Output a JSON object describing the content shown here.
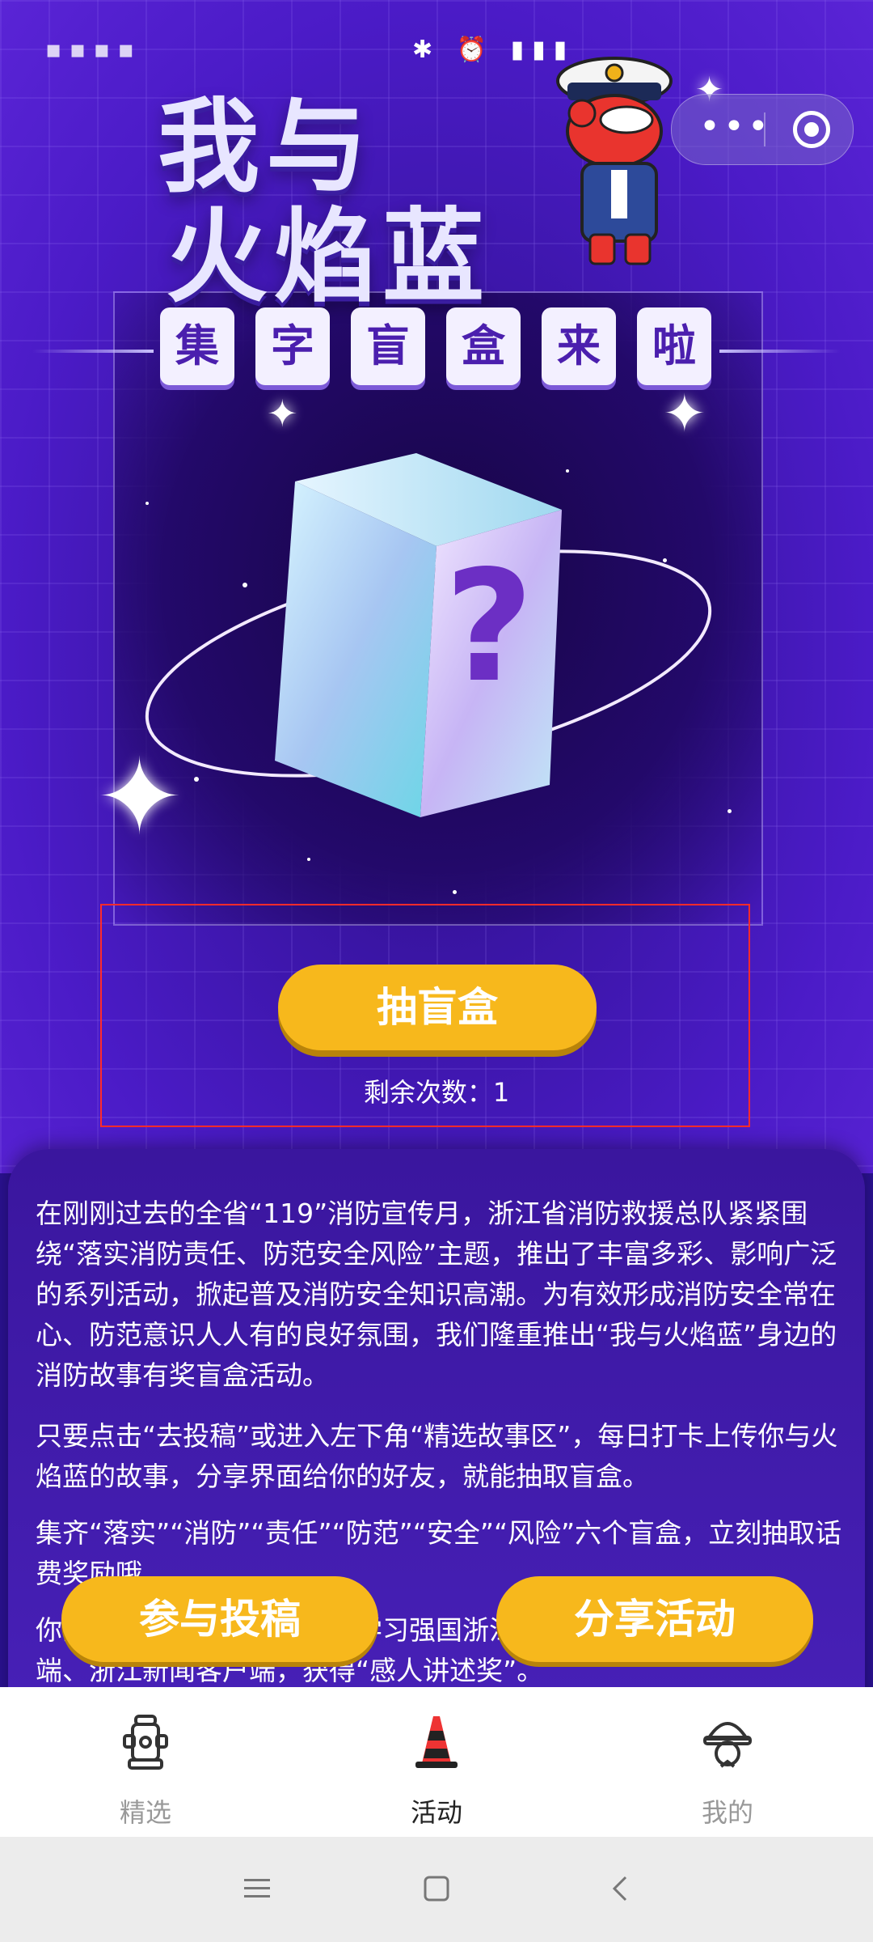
{
  "title": {
    "line1": "我与",
    "line2": "火焰蓝",
    "tiles": [
      "集",
      "字",
      "盲",
      "盒",
      "来",
      "啦"
    ]
  },
  "hero": {
    "draw_button": "抽盲盒",
    "remaining": "剩余次数：1"
  },
  "article": {
    "p1": "在刚刚过去的全省“119”消防宣传月，浙江省消防救援总队紧紧围绕“落实消防责任、防范安全风险”主题，推出了丰富多彩、影响广泛的系列活动，掀起普及消防安全知识高潮。为有效形成消防安全常在心、防范意识人人有的良好氛围，我们隆重推出“我与火焰蓝”身边的消防故事有奖盲盒活动。",
    "p2": "只要点击“去投稿”或进入左下角“精选故事区”，每日打卡上传你与火焰蓝的故事，分享界面给你的好友，就能抽取盲盒。",
    "p3": "集齐“落实”“消防”“责任”“防范”“安全”“风险”六个盲盒，立刻抽取话费奖励哦。",
    "p4": "你的故事还有机会被选送至学习强国浙江学习平台、浙江日报客户端、浙江新闻客户端，获得“感人讲述奖”。"
  },
  "actions": {
    "submit": "参与投稿",
    "share": "分享活动"
  },
  "tabs": [
    {
      "label": "精选",
      "icon": "fire-hydrant-icon",
      "active": false
    },
    {
      "label": "活动",
      "icon": "traffic-cone-icon",
      "active": true
    },
    {
      "label": "我的",
      "icon": "firefighter-helmet-icon",
      "active": false
    }
  ],
  "colors": {
    "accent": "#f7b81c",
    "background": "#4b1bc7",
    "highlight_box": "#ff2b2b"
  }
}
